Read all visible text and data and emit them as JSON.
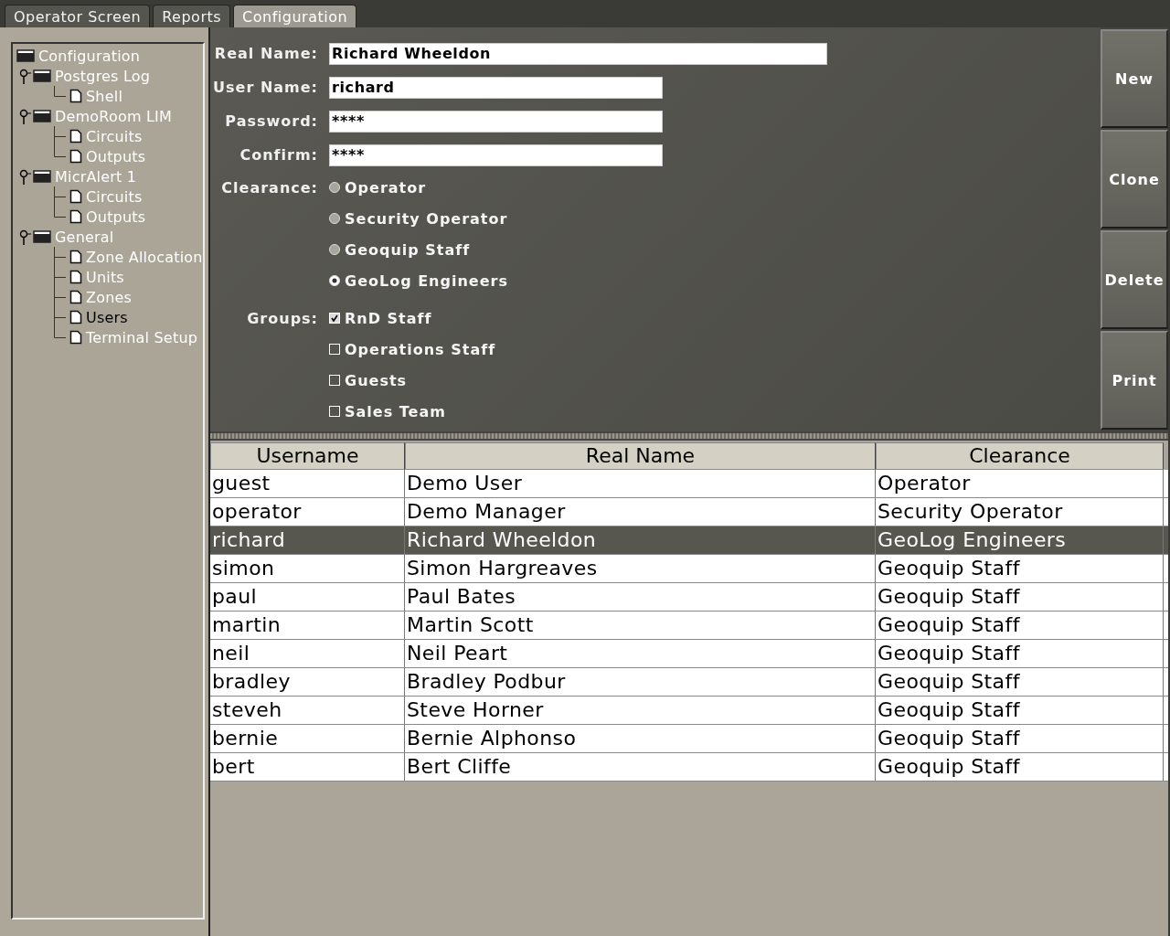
{
  "tabs": [
    {
      "label": "Operator Screen",
      "selected": false
    },
    {
      "label": "Reports",
      "selected": false
    },
    {
      "label": "Configuration",
      "selected": true
    }
  ],
  "tree": [
    {
      "label": "Configuration",
      "kind": "folder",
      "selected": false,
      "children": [
        {
          "label": "Postgres Log",
          "kind": "folder",
          "selected": false,
          "expanded": true,
          "children": [
            {
              "label": "Shell",
              "kind": "page",
              "selected": false
            }
          ]
        },
        {
          "label": "DemoRoom LIM",
          "kind": "folder",
          "selected": false,
          "expanded": true,
          "children": [
            {
              "label": "Circuits",
              "kind": "page",
              "selected": false
            },
            {
              "label": "Outputs",
              "kind": "page",
              "selected": false
            }
          ]
        },
        {
          "label": "MicrAlert 1",
          "kind": "folder",
          "selected": false,
          "expanded": true,
          "children": [
            {
              "label": "Circuits",
              "kind": "page",
              "selected": false
            },
            {
              "label": "Outputs",
              "kind": "page",
              "selected": false
            }
          ]
        },
        {
          "label": "General",
          "kind": "folder",
          "selected": false,
          "expanded": true,
          "children": [
            {
              "label": "Zone Allocation",
              "kind": "page",
              "selected": false
            },
            {
              "label": "Units",
              "kind": "page",
              "selected": false
            },
            {
              "label": "Zones",
              "kind": "page",
              "selected": false
            },
            {
              "label": "Users",
              "kind": "page",
              "selected": true
            },
            {
              "label": "Terminal Setup",
              "kind": "page",
              "selected": false
            }
          ]
        }
      ]
    }
  ],
  "form": {
    "fields": [
      {
        "label": "Real Name:",
        "value": "Richard Wheeldon",
        "kind": "wide"
      },
      {
        "label": "User Name:",
        "value": "richard",
        "kind": "narrow"
      },
      {
        "label": "Password:",
        "value": "****",
        "kind": "narrow"
      },
      {
        "label": "Confirm:",
        "value": "****",
        "kind": "narrow"
      }
    ],
    "clearance": {
      "label": "Clearance:",
      "options": [
        {
          "label": "Operator",
          "selected": false
        },
        {
          "label": "Security Operator",
          "selected": false
        },
        {
          "label": "Geoquip Staff",
          "selected": false
        },
        {
          "label": "GeoLog Engineers",
          "selected": true
        }
      ]
    },
    "groups": {
      "label": "Groups:",
      "options": [
        {
          "label": "RnD Staff",
          "checked": true
        },
        {
          "label": "Operations Staff",
          "checked": false
        },
        {
          "label": "Guests",
          "checked": false
        },
        {
          "label": "Sales Team",
          "checked": false
        }
      ]
    }
  },
  "buttons": [
    "New",
    "Clone",
    "Delete",
    "Print"
  ],
  "table": {
    "columns": [
      "Username",
      "Real Name",
      "Clearance"
    ],
    "rows": [
      {
        "cells": [
          "guest",
          "Demo User",
          "Operator"
        ],
        "selected": false
      },
      {
        "cells": [
          "operator",
          "Demo Manager",
          "Security Operator"
        ],
        "selected": false
      },
      {
        "cells": [
          "richard",
          "Richard Wheeldon",
          "GeoLog Engineers"
        ],
        "selected": true
      },
      {
        "cells": [
          "simon",
          "Simon Hargreaves",
          "Geoquip Staff"
        ],
        "selected": false
      },
      {
        "cells": [
          "paul",
          "Paul Bates",
          "Geoquip Staff"
        ],
        "selected": false
      },
      {
        "cells": [
          "martin",
          "Martin Scott",
          "Geoquip Staff"
        ],
        "selected": false
      },
      {
        "cells": [
          "neil",
          "Neil Peart",
          "Geoquip Staff"
        ],
        "selected": false
      },
      {
        "cells": [
          "bradley",
          "Bradley Podbur",
          "Geoquip Staff"
        ],
        "selected": false
      },
      {
        "cells": [
          "steveh",
          "Steve Horner",
          "Geoquip Staff"
        ],
        "selected": false
      },
      {
        "cells": [
          "bernie",
          "Bernie Alphonso",
          "Geoquip Staff"
        ],
        "selected": false
      },
      {
        "cells": [
          "bert",
          "Bert Cliffe",
          "Geoquip Staff"
        ],
        "selected": false
      }
    ]
  }
}
